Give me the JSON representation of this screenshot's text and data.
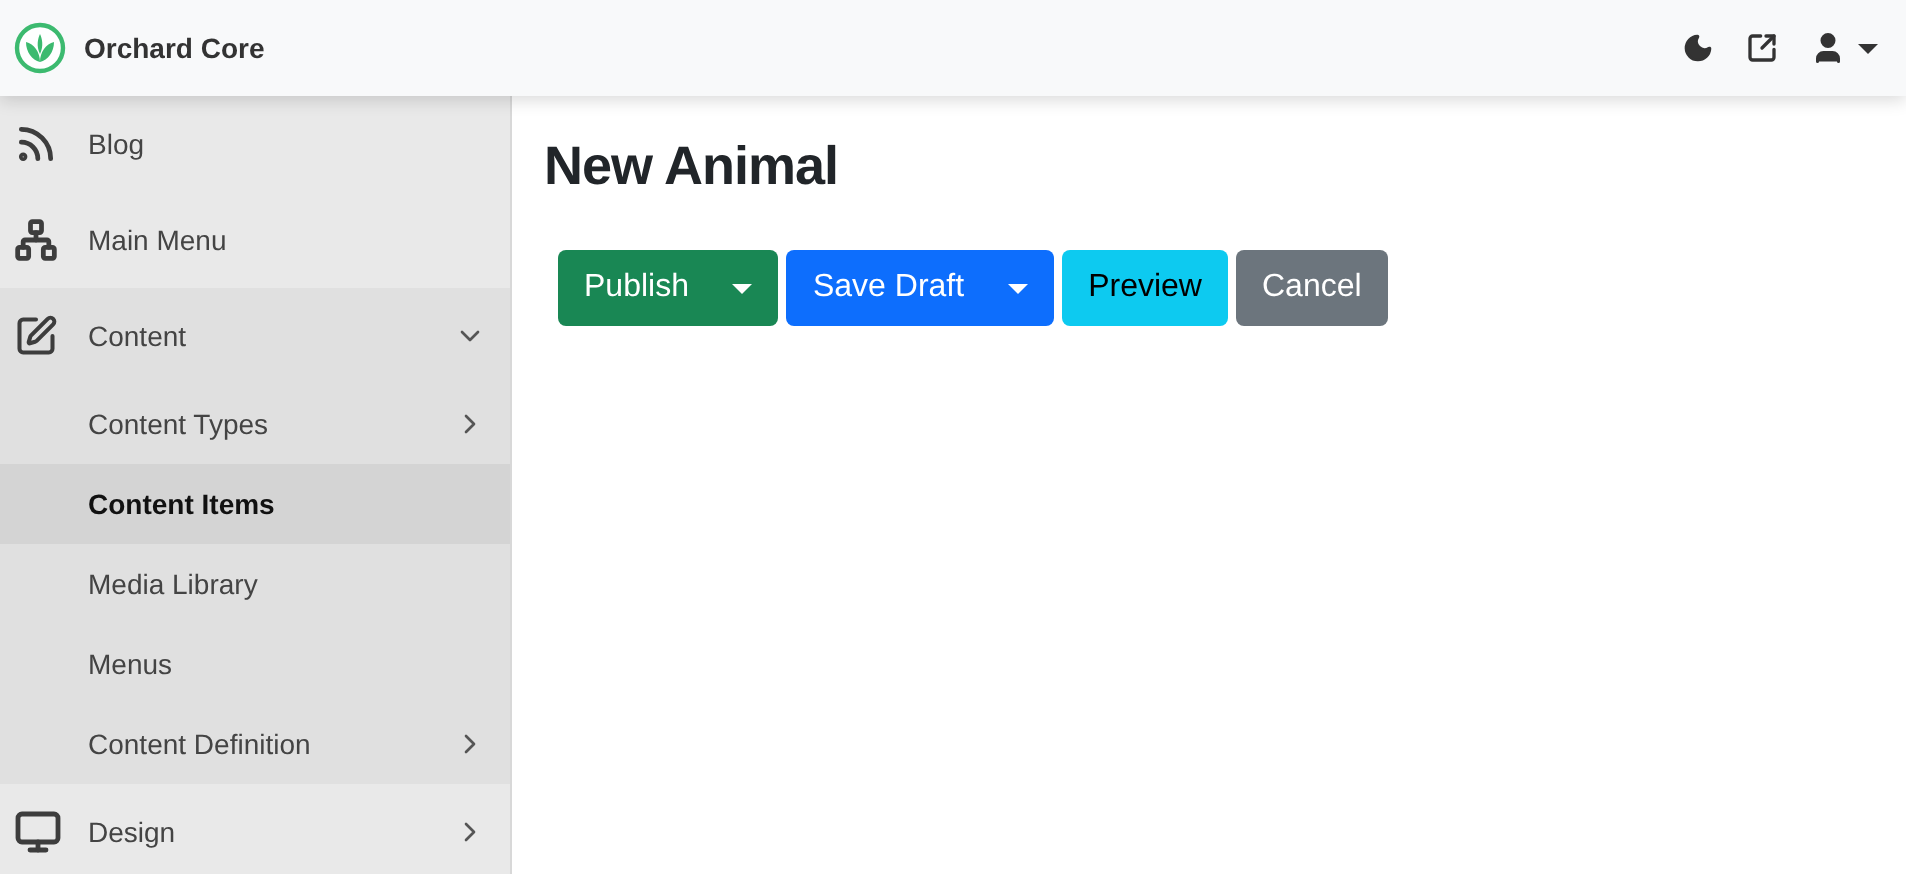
{
  "header": {
    "brand": "Orchard Core"
  },
  "sidebar": {
    "items": [
      {
        "label": "Blog",
        "selected": false
      },
      {
        "label": "Main Menu",
        "selected": false
      },
      {
        "label": "Content",
        "selected": false,
        "expanded": true,
        "children": [
          {
            "label": "Content Types",
            "selected": false,
            "expanded": false
          },
          {
            "label": "Content Items",
            "selected": true
          },
          {
            "label": "Media Library",
            "selected": false
          },
          {
            "label": "Menus",
            "selected": false
          },
          {
            "label": "Content Definition",
            "selected": false,
            "expanded": false
          }
        ]
      },
      {
        "label": "Design",
        "selected": false,
        "expanded": false
      }
    ]
  },
  "page": {
    "title": "New Animal"
  },
  "buttons": [
    {
      "label": "Publish",
      "kind": "split"
    },
    {
      "label": "Save Draft",
      "kind": "split"
    },
    {
      "label": "Preview",
      "kind": "plain"
    },
    {
      "label": "Cancel",
      "kind": "plain"
    }
  ]
}
